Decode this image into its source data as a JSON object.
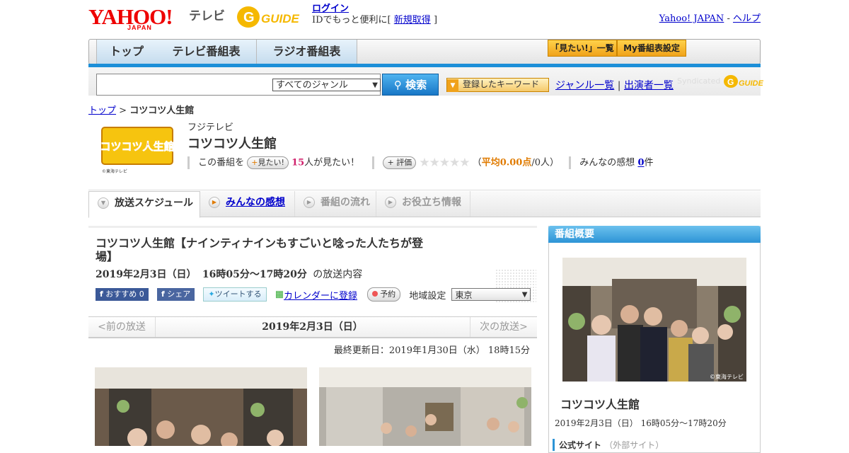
{
  "header": {
    "logo_text": "YAHOO!",
    "logo_sub": "JAPAN",
    "logo_tv": "テレビ",
    "gguide": "GUIDE",
    "login_label": "ログイン",
    "login_desc": "IDでもっと便利に[",
    "signup_label": "新規取得",
    "login_suffix": "]",
    "yahoo_link": "Yahoo! JAPAN",
    "sep": "-",
    "help_link": "ヘルプ"
  },
  "nav": {
    "tabs": [
      "トップ",
      "テレビ番組表",
      "ラジオ番組表"
    ],
    "mitai_list": "「見たい!」一覧",
    "my_table": "My番組表設定"
  },
  "search": {
    "genre_value": "すべてのジャンル",
    "button": "検索",
    "keywords": "登録したキーワード",
    "genre_list": "ジャンル一覧",
    "link_sep": "|",
    "cast_list": "出演者一覧",
    "syndicated": "Syndicated"
  },
  "breadcrumb": {
    "top": "トップ",
    "sep": ">",
    "current": "コツコツ人生館"
  },
  "program": {
    "logo_text": "コツコツ人生館",
    "logo_credit": "©東海テレビ",
    "channel": "フジテレビ",
    "title": "コツコツ人生館",
    "mitai_prefix": "この番組を",
    "mitai_btn": "見たい!",
    "mitai_count": "15",
    "mitai_suffix": "人が見たい！",
    "rate_btn": "評価",
    "stars": "★★★★★",
    "avg_open": "（",
    "avg_label": "平均0.00点",
    "avg_suffix": "/0人）",
    "impressions_label": "みんなの感想",
    "impressions_count": "0",
    "impressions_suffix": "件"
  },
  "tabs": [
    {
      "label": "放送スケジュール",
      "state": "active"
    },
    {
      "label": "みんなの感想",
      "state": "link"
    },
    {
      "label": "番組の流れ",
      "state": "disabled"
    },
    {
      "label": "お役立ち情報",
      "state": "disabled"
    }
  ],
  "episode": {
    "title": "コツコツ人生館【ナインティナインもすごいと唸った人たちが登場】",
    "date": "2019年2月3日（日）",
    "time": "16時05分～17時20分",
    "date_suffix": "の放送内容",
    "recommend": "おすすめ",
    "recommend_count": "0",
    "share": "シェア",
    "tweet": "ツイートする",
    "calendar": "カレンダーに登録",
    "reserve": "予約",
    "region_label": "地域設定",
    "region_value": "東京"
  },
  "pager": {
    "prev": "<前の放送",
    "current": "2019年2月3日（日）",
    "next": "次の放送>"
  },
  "updated": "最終更新日：2019年1月30日（水）  18時15分",
  "sidebar": {
    "heading": "番組概要",
    "photo_credit": "©東海テレビ",
    "title": "コツコツ人生館",
    "time": "2019年2月3日（日）  16時05分～17時20分",
    "official_site": "公式サイト",
    "external": "（外部サイト）"
  },
  "colors": {
    "accent": "#1d8fd8",
    "pink": "#d0216c",
    "orange": "#e07b00"
  }
}
